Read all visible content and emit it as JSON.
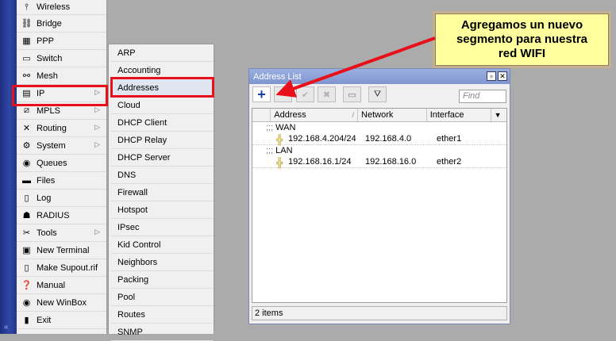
{
  "main_menu": {
    "items": [
      {
        "label": "Wireless",
        "icon": "wireless-icon",
        "glyph": "⫯",
        "arrow": false
      },
      {
        "label": "Bridge",
        "icon": "bridge-icon",
        "glyph": "⛓",
        "arrow": false
      },
      {
        "label": "PPP",
        "icon": "ppp-icon",
        "glyph": "▦",
        "arrow": false
      },
      {
        "label": "Switch",
        "icon": "switch-icon",
        "glyph": "▭",
        "arrow": false
      },
      {
        "label": "Mesh",
        "icon": "mesh-icon",
        "glyph": "⚯",
        "arrow": false
      },
      {
        "label": "IP",
        "icon": "ip-icon",
        "glyph": "▤",
        "arrow": true
      },
      {
        "label": "MPLS",
        "icon": "mpls-icon",
        "glyph": "⧄",
        "arrow": true
      },
      {
        "label": "Routing",
        "icon": "routing-icon",
        "glyph": "✕",
        "arrow": true
      },
      {
        "label": "System",
        "icon": "system-icon",
        "glyph": "⚙",
        "arrow": true
      },
      {
        "label": "Queues",
        "icon": "queues-icon",
        "glyph": "◉",
        "arrow": false
      },
      {
        "label": "Files",
        "icon": "files-icon",
        "glyph": "▬",
        "arrow": false
      },
      {
        "label": "Log",
        "icon": "log-icon",
        "glyph": "▯",
        "arrow": false
      },
      {
        "label": "RADIUS",
        "icon": "radius-icon",
        "glyph": "☗",
        "arrow": false
      },
      {
        "label": "Tools",
        "icon": "tools-icon",
        "glyph": "✂",
        "arrow": true
      },
      {
        "label": "New Terminal",
        "icon": "terminal-icon",
        "glyph": "▣",
        "arrow": false
      },
      {
        "label": "Make Supout.rif",
        "icon": "supout-icon",
        "glyph": "▯",
        "arrow": false
      },
      {
        "label": "Manual",
        "icon": "manual-icon",
        "glyph": "❓",
        "arrow": false
      },
      {
        "label": "New WinBox",
        "icon": "winbox-icon",
        "glyph": "◉",
        "arrow": false
      },
      {
        "label": "Exit",
        "icon": "exit-icon",
        "glyph": "▮",
        "arrow": false
      }
    ]
  },
  "ip_submenu": {
    "items": [
      "ARP",
      "Accounting",
      "Addresses",
      "Cloud",
      "DHCP Client",
      "DHCP Relay",
      "DHCP Server",
      "DNS",
      "Firewall",
      "Hotspot",
      "IPsec",
      "Kid Control",
      "Neighbors",
      "Packing",
      "Pool",
      "Routes",
      "SNMP"
    ],
    "selected": "Addresses"
  },
  "window": {
    "title": "Address List",
    "find_placeholder": "Find",
    "columns": [
      "Address",
      "Network",
      "Interface"
    ],
    "groups": [
      {
        "comment_prefix": ";;;",
        "name": "WAN",
        "rows": [
          {
            "address": "192.168.4.204/24",
            "network": "192.168.4.0",
            "interface": "ether1"
          }
        ]
      },
      {
        "comment_prefix": ";;;",
        "name": "LAN",
        "rows": [
          {
            "address": "192.168.16.1/24",
            "network": "192.168.16.0",
            "interface": "ether2"
          }
        ]
      }
    ],
    "status": "2 items"
  },
  "callout": {
    "line1": "Agregamos un nuevo",
    "line2": "segmento para nuestra",
    "line3": "red WIFI"
  },
  "colors": {
    "highlight": "#e8101a",
    "callout_bg": "#ffff9e",
    "add_icon": "#1b3fa8"
  }
}
